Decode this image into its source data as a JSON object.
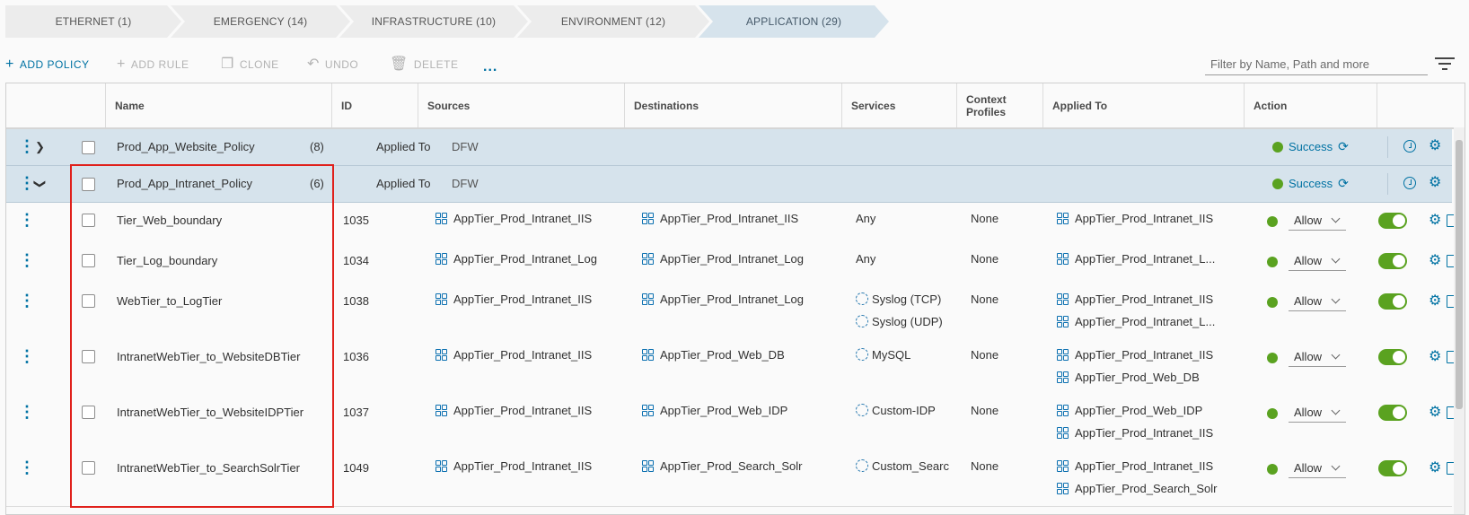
{
  "tabs": [
    {
      "label": "ETHERNET (1)"
    },
    {
      "label": "EMERGENCY (14)"
    },
    {
      "label": "INFRASTRUCTURE (10)"
    },
    {
      "label": "ENVIRONMENT (12)"
    },
    {
      "label": "APPLICATION (29)",
      "active": true
    }
  ],
  "toolbar": {
    "add_policy": "ADD POLICY",
    "add_rule": "ADD RULE",
    "clone": "CLONE",
    "undo": "UNDO",
    "delete": "DELETE",
    "more": "...",
    "filter_placeholder": "Filter by Name, Path and more"
  },
  "columns": {
    "name": "Name",
    "id": "ID",
    "sources": "Sources",
    "destinations": "Destinations",
    "services": "Services",
    "context_profiles": "Context Profiles",
    "applied_to": "Applied To",
    "action": "Action"
  },
  "policies": [
    {
      "name": "Prod_App_Website_Policy",
      "count": "(8)",
      "applied_to_label": "Applied To",
      "applied_to": "DFW",
      "status": "Success",
      "expanded": false
    },
    {
      "name": "Prod_App_Intranet_Policy",
      "count": "(6)",
      "applied_to_label": "Applied To",
      "applied_to": "DFW",
      "status": "Success",
      "expanded": true
    }
  ],
  "rules": [
    {
      "name": "Tier_Web_boundary",
      "id": "1035",
      "source": "AppTier_Prod_Intranet_IIS",
      "destination": "AppTier_Prod_Intranet_IIS",
      "services": [
        "Any"
      ],
      "context": "None",
      "applied_to": [
        "AppTier_Prod_Intranet_IIS"
      ],
      "action": "Allow"
    },
    {
      "name": "Tier_Log_boundary",
      "id": "1034",
      "source": "AppTier_Prod_Intranet_Log",
      "destination": "AppTier_Prod_Intranet_Log",
      "services": [
        "Any"
      ],
      "context": "None",
      "applied_to": [
        "AppTier_Prod_Intranet_L..."
      ],
      "action": "Allow"
    },
    {
      "name": "WebTier_to_LogTier",
      "id": "1038",
      "source": "AppTier_Prod_Intranet_IIS",
      "destination": "AppTier_Prod_Intranet_Log",
      "services": [
        "Syslog (TCP)",
        "Syslog (UDP)"
      ],
      "context": "None",
      "applied_to": [
        "AppTier_Prod_Intranet_IIS",
        "AppTier_Prod_Intranet_L..."
      ],
      "action": "Allow"
    },
    {
      "name": "IntranetWebTier_to_WebsiteDBTier",
      "id": "1036",
      "source": "AppTier_Prod_Intranet_IIS",
      "destination": "AppTier_Prod_Web_DB",
      "services": [
        "MySQL"
      ],
      "context": "None",
      "applied_to": [
        "AppTier_Prod_Intranet_IIS",
        "AppTier_Prod_Web_DB"
      ],
      "action": "Allow"
    },
    {
      "name": "IntranetWebTier_to_WebsiteIDPTier",
      "id": "1037",
      "source": "AppTier_Prod_Intranet_IIS",
      "destination": "AppTier_Prod_Web_IDP",
      "services": [
        "Custom-IDP"
      ],
      "context": "None",
      "applied_to": [
        "AppTier_Prod_Web_IDP",
        "AppTier_Prod_Intranet_IIS"
      ],
      "action": "Allow"
    },
    {
      "name": "IntranetWebTier_to_SearchSolrTier",
      "id": "1049",
      "source": "AppTier_Prod_Intranet_IIS",
      "destination": "AppTier_Prod_Search_Solr",
      "services": [
        "Custom_Searc"
      ],
      "context": "None",
      "applied_to": [
        "AppTier_Prod_Intranet_IIS",
        "AppTier_Prod_Search_Solr"
      ],
      "action": "Allow"
    }
  ],
  "colors": {
    "accent": "#0072a3",
    "success": "#5aa220",
    "highlight": "#e0201b",
    "policy_row": "#d6e3ec"
  }
}
